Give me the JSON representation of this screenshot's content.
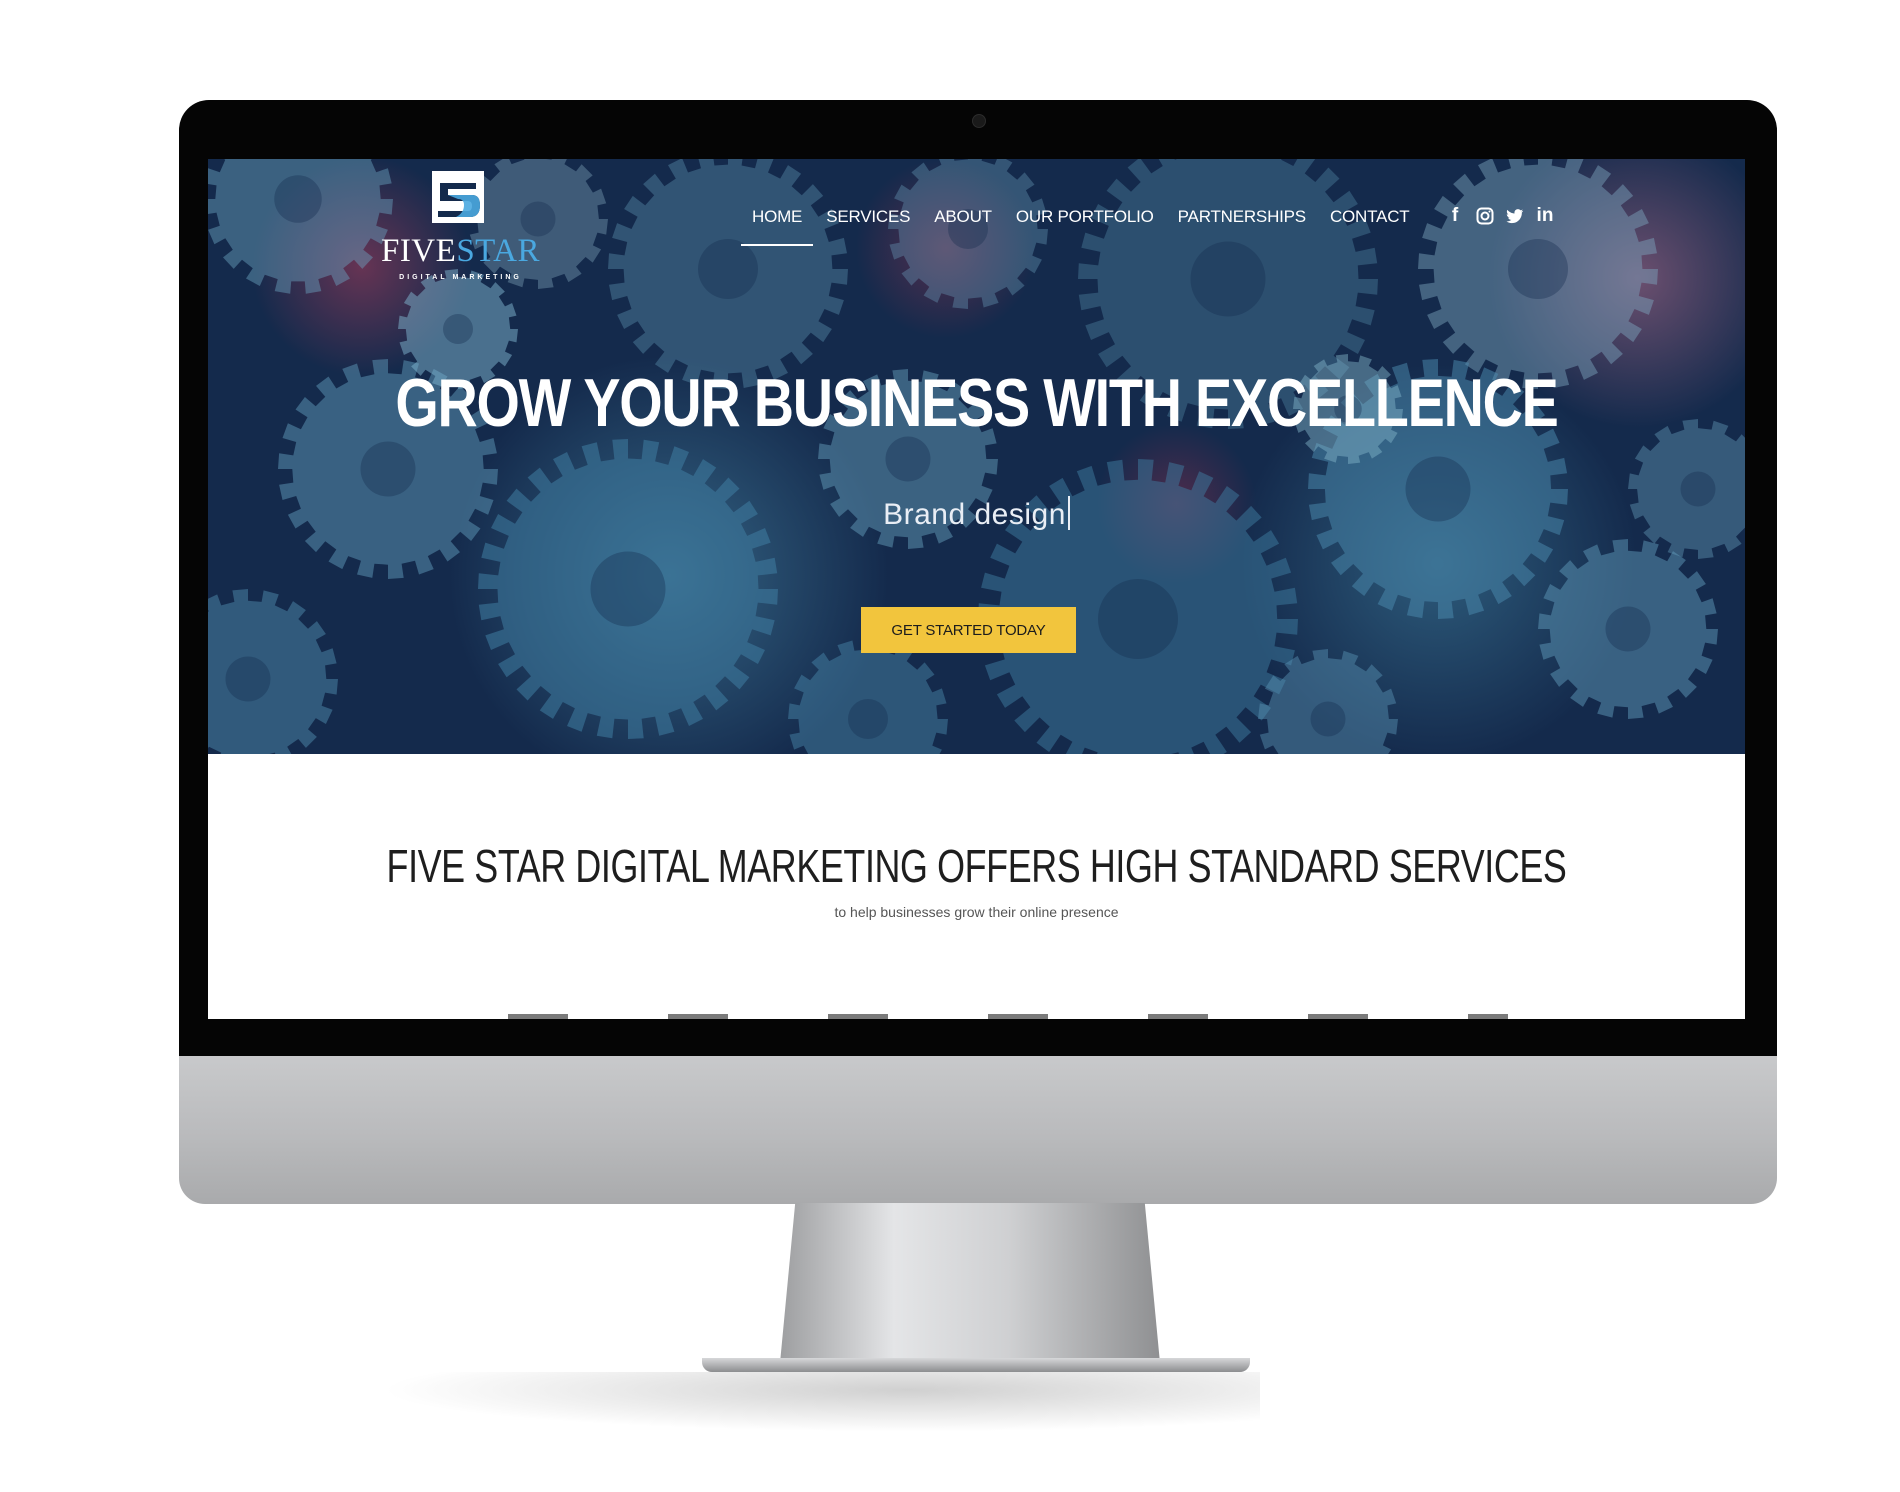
{
  "brand": {
    "name_part1": "FIVE",
    "name_part2": "STAR",
    "tagline": "DIGITAL MARKETING",
    "accent_color": "#4aa8e0"
  },
  "nav": {
    "items": [
      {
        "label": "HOME",
        "active": true
      },
      {
        "label": "SERVICES",
        "active": false
      },
      {
        "label": "ABOUT",
        "active": false
      },
      {
        "label": "OUR PORTFOLIO",
        "active": false
      },
      {
        "label": "PARTNERSHIPS",
        "active": false
      },
      {
        "label": "CONTACT",
        "active": false
      }
    ]
  },
  "social": {
    "icons": [
      "facebook-icon",
      "instagram-icon",
      "twitter-icon",
      "linkedin-icon"
    ],
    "facebook_glyph": "f",
    "twitter_glyph": "🐦",
    "linkedin_glyph": "in"
  },
  "hero": {
    "title": "GROW YOUR BUSINESS WITH EXCELLENCE",
    "typed_text": "Brand design",
    "cta_label": "GET STARTED TODAY",
    "cta_color": "#f2c53d",
    "background_color": "#142a4c"
  },
  "intro": {
    "title": "FIVE STAR DIGITAL MARKETING OFFERS HIGH STANDARD SERVICES",
    "subtitle": "to help businesses grow their online presence"
  }
}
